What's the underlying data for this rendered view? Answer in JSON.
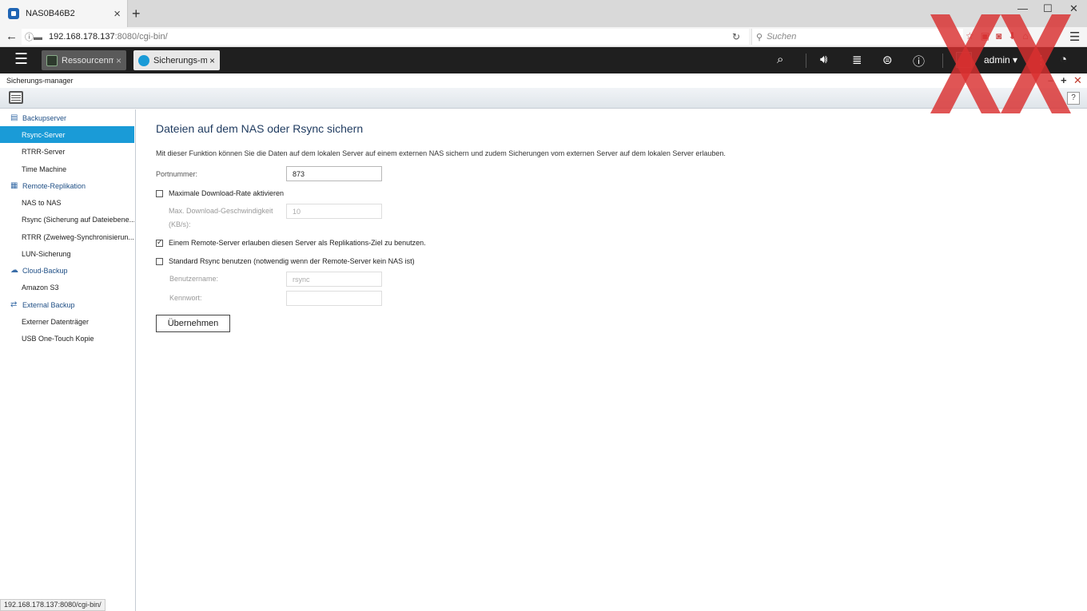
{
  "browser": {
    "tab_title": "NAS0B46B2",
    "tab_close": "×",
    "new_tab": "+",
    "url_host": "192.168.178.137",
    "url_path": ":8080/cgi-bin/",
    "search_placeholder": "Suchen"
  },
  "desktop": {
    "tabs": [
      {
        "label": "Ressourcenm...",
        "close": "×"
      },
      {
        "label": "Sicherungs-m...",
        "close": "×"
      }
    ],
    "user": "admin ▾"
  },
  "app": {
    "title": "Sicherungs-manager",
    "help": "?"
  },
  "sidebar": {
    "groups": [
      {
        "label": "Backupserver",
        "items": [
          "Rsync-Server",
          "RTRR-Server",
          "Time Machine"
        ]
      },
      {
        "label": "Remote-Replikation",
        "items": [
          "NAS to NAS",
          "Rsync (Sicherung auf Dateiebene...",
          "RTRR (Zweiweg-Synchronisierun...",
          "LUN-Sicherung"
        ]
      },
      {
        "label": "Cloud-Backup",
        "items": [
          "Amazon S3"
        ]
      },
      {
        "label": "External Backup",
        "items": [
          "Externer Datenträger",
          "USB One-Touch Kopie"
        ]
      }
    ],
    "active_item": "Rsync-Server"
  },
  "main": {
    "title": "Dateien auf dem NAS oder Rsync sichern",
    "description": "Mit dieser Funktion können Sie die Daten auf dem lokalen Server auf einem externen NAS sichern und zudem Sicherungen vom externen Server auf dem lokalen Server erlauben.",
    "port_label": "Portnummer:",
    "port_value": "873",
    "max_rate_checkbox": {
      "label": "Maximale Download-Rate aktivieren",
      "checked": false
    },
    "max_speed_label_1": "Max. Download-Geschwindigkeit",
    "max_speed_label_2": "(KB/s):",
    "max_speed_value": "10",
    "allow_remote_checkbox": {
      "label": "Einem Remote-Server erlauben diesen Server als Replikations-Ziel zu benutzen.",
      "checked": true
    },
    "standard_rsync_checkbox": {
      "label": "Standard Rsync benutzen (notwendig wenn der Remote-Server kein NAS ist)",
      "checked": false
    },
    "username_label": "Benutzername:",
    "username_value": "rsync",
    "password_label": "Kennwort:",
    "password_value": "",
    "apply_button": "Übernehmen"
  },
  "statusbar": "192.168.178.137:8080/cgi-bin/",
  "colors": {
    "accent": "#1a9bd7",
    "topbar": "#1f1f1f",
    "watermark": "#d93030"
  }
}
